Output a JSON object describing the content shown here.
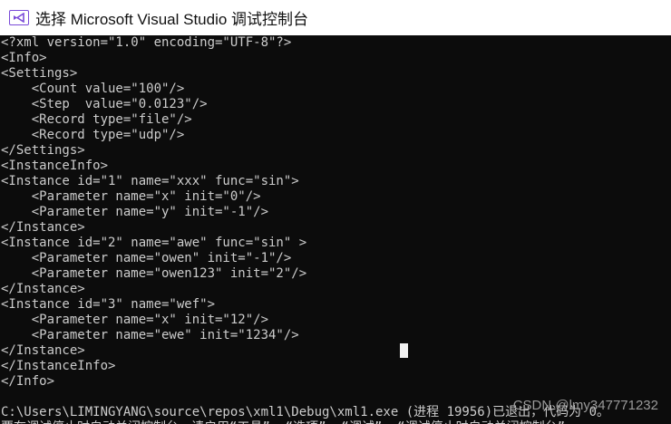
{
  "window": {
    "title": "选择 Microsoft Visual Studio 调试控制台",
    "icon": "visual-studio-icon",
    "accent": "#7a4bd8"
  },
  "console": {
    "background": "#0c0c0c",
    "foreground": "#cccccc",
    "lines": [
      "<?xml version=\"1.0\" encoding=\"UTF-8\"?>",
      "<Info>",
      "<Settings>",
      "    <Count value=\"100\"/>",
      "    <Step  value=\"0.0123\"/>",
      "    <Record type=\"file\"/>",
      "    <Record type=\"udp\"/>",
      "</Settings>",
      "<InstanceInfo>",
      "<Instance id=\"1\" name=\"xxx\" func=\"sin\">",
      "    <Parameter name=\"x\" init=\"0\"/>",
      "    <Parameter name=\"y\" init=\"-1\"/>",
      "</Instance>",
      "<Instance id=\"2\" name=\"awe\" func=\"sin\" >",
      "    <Parameter name=\"owen\" init=\"-1\"/>",
      "    <Parameter name=\"owen123\" init=\"2\"/>",
      "</Instance>",
      "<Instance id=\"3\" name=\"wef\">",
      "    <Parameter name=\"x\" init=\"12\"/>",
      "    <Parameter name=\"ewe\" init=\"1234\"/>",
      "</Instance>",
      "</InstanceInfo>",
      "</Info>",
      "",
      "C:\\Users\\LIMINGYANG\\source\\repos\\xml1\\Debug\\xml1.exe (进程 19956)已退出，代码为 0。",
      "要在调试停止时自动关闭控制台，请启用“工具”->“选项”->“调试”->“调试停止时自动关闭控制台”。"
    ]
  },
  "watermark": "CSDN @lmy347771232"
}
